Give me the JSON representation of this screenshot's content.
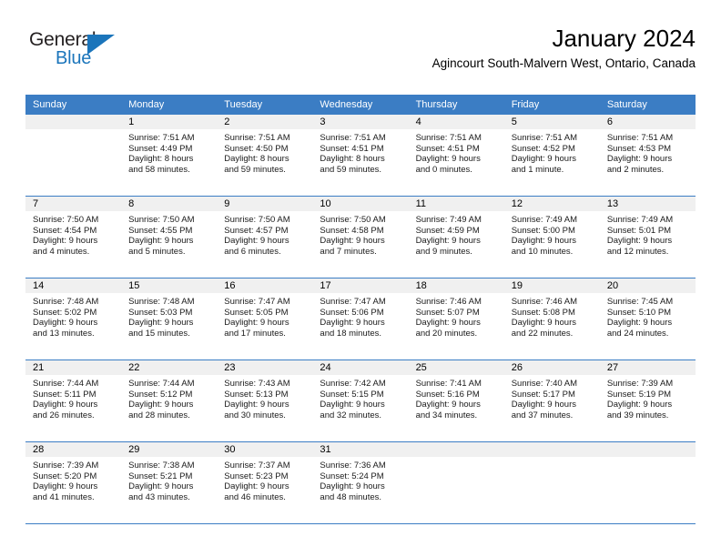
{
  "logo": {
    "word_top": "General",
    "word_bottom": "Blue",
    "accent_color": "#1b75bb"
  },
  "header": {
    "title": "January 2024",
    "subtitle": "Agincourt South-Malvern West, Ontario, Canada"
  },
  "theme": {
    "header_bg": "#3b7dc4",
    "header_text": "#ffffff",
    "daynum_bg": "#f0f0f0",
    "grid_line": "#3b7dc4"
  },
  "weekday_headers": [
    "Sunday",
    "Monday",
    "Tuesday",
    "Wednesday",
    "Thursday",
    "Friday",
    "Saturday"
  ],
  "weeks": [
    [
      {
        "day": "",
        "sunrise": "",
        "sunset": "",
        "daylight_line1": "",
        "daylight_line2": ""
      },
      {
        "day": "1",
        "sunrise": "Sunrise: 7:51 AM",
        "sunset": "Sunset: 4:49 PM",
        "daylight_line1": "Daylight: 8 hours",
        "daylight_line2": "and 58 minutes."
      },
      {
        "day": "2",
        "sunrise": "Sunrise: 7:51 AM",
        "sunset": "Sunset: 4:50 PM",
        "daylight_line1": "Daylight: 8 hours",
        "daylight_line2": "and 59 minutes."
      },
      {
        "day": "3",
        "sunrise": "Sunrise: 7:51 AM",
        "sunset": "Sunset: 4:51 PM",
        "daylight_line1": "Daylight: 8 hours",
        "daylight_line2": "and 59 minutes."
      },
      {
        "day": "4",
        "sunrise": "Sunrise: 7:51 AM",
        "sunset": "Sunset: 4:51 PM",
        "daylight_line1": "Daylight: 9 hours",
        "daylight_line2": "and 0 minutes."
      },
      {
        "day": "5",
        "sunrise": "Sunrise: 7:51 AM",
        "sunset": "Sunset: 4:52 PM",
        "daylight_line1": "Daylight: 9 hours",
        "daylight_line2": "and 1 minute."
      },
      {
        "day": "6",
        "sunrise": "Sunrise: 7:51 AM",
        "sunset": "Sunset: 4:53 PM",
        "daylight_line1": "Daylight: 9 hours",
        "daylight_line2": "and 2 minutes."
      }
    ],
    [
      {
        "day": "7",
        "sunrise": "Sunrise: 7:50 AM",
        "sunset": "Sunset: 4:54 PM",
        "daylight_line1": "Daylight: 9 hours",
        "daylight_line2": "and 4 minutes."
      },
      {
        "day": "8",
        "sunrise": "Sunrise: 7:50 AM",
        "sunset": "Sunset: 4:55 PM",
        "daylight_line1": "Daylight: 9 hours",
        "daylight_line2": "and 5 minutes."
      },
      {
        "day": "9",
        "sunrise": "Sunrise: 7:50 AM",
        "sunset": "Sunset: 4:57 PM",
        "daylight_line1": "Daylight: 9 hours",
        "daylight_line2": "and 6 minutes."
      },
      {
        "day": "10",
        "sunrise": "Sunrise: 7:50 AM",
        "sunset": "Sunset: 4:58 PM",
        "daylight_line1": "Daylight: 9 hours",
        "daylight_line2": "and 7 minutes."
      },
      {
        "day": "11",
        "sunrise": "Sunrise: 7:49 AM",
        "sunset": "Sunset: 4:59 PM",
        "daylight_line1": "Daylight: 9 hours",
        "daylight_line2": "and 9 minutes."
      },
      {
        "day": "12",
        "sunrise": "Sunrise: 7:49 AM",
        "sunset": "Sunset: 5:00 PM",
        "daylight_line1": "Daylight: 9 hours",
        "daylight_line2": "and 10 minutes."
      },
      {
        "day": "13",
        "sunrise": "Sunrise: 7:49 AM",
        "sunset": "Sunset: 5:01 PM",
        "daylight_line1": "Daylight: 9 hours",
        "daylight_line2": "and 12 minutes."
      }
    ],
    [
      {
        "day": "14",
        "sunrise": "Sunrise: 7:48 AM",
        "sunset": "Sunset: 5:02 PM",
        "daylight_line1": "Daylight: 9 hours",
        "daylight_line2": "and 13 minutes."
      },
      {
        "day": "15",
        "sunrise": "Sunrise: 7:48 AM",
        "sunset": "Sunset: 5:03 PM",
        "daylight_line1": "Daylight: 9 hours",
        "daylight_line2": "and 15 minutes."
      },
      {
        "day": "16",
        "sunrise": "Sunrise: 7:47 AM",
        "sunset": "Sunset: 5:05 PM",
        "daylight_line1": "Daylight: 9 hours",
        "daylight_line2": "and 17 minutes."
      },
      {
        "day": "17",
        "sunrise": "Sunrise: 7:47 AM",
        "sunset": "Sunset: 5:06 PM",
        "daylight_line1": "Daylight: 9 hours",
        "daylight_line2": "and 18 minutes."
      },
      {
        "day": "18",
        "sunrise": "Sunrise: 7:46 AM",
        "sunset": "Sunset: 5:07 PM",
        "daylight_line1": "Daylight: 9 hours",
        "daylight_line2": "and 20 minutes."
      },
      {
        "day": "19",
        "sunrise": "Sunrise: 7:46 AM",
        "sunset": "Sunset: 5:08 PM",
        "daylight_line1": "Daylight: 9 hours",
        "daylight_line2": "and 22 minutes."
      },
      {
        "day": "20",
        "sunrise": "Sunrise: 7:45 AM",
        "sunset": "Sunset: 5:10 PM",
        "daylight_line1": "Daylight: 9 hours",
        "daylight_line2": "and 24 minutes."
      }
    ],
    [
      {
        "day": "21",
        "sunrise": "Sunrise: 7:44 AM",
        "sunset": "Sunset: 5:11 PM",
        "daylight_line1": "Daylight: 9 hours",
        "daylight_line2": "and 26 minutes."
      },
      {
        "day": "22",
        "sunrise": "Sunrise: 7:44 AM",
        "sunset": "Sunset: 5:12 PM",
        "daylight_line1": "Daylight: 9 hours",
        "daylight_line2": "and 28 minutes."
      },
      {
        "day": "23",
        "sunrise": "Sunrise: 7:43 AM",
        "sunset": "Sunset: 5:13 PM",
        "daylight_line1": "Daylight: 9 hours",
        "daylight_line2": "and 30 minutes."
      },
      {
        "day": "24",
        "sunrise": "Sunrise: 7:42 AM",
        "sunset": "Sunset: 5:15 PM",
        "daylight_line1": "Daylight: 9 hours",
        "daylight_line2": "and 32 minutes."
      },
      {
        "day": "25",
        "sunrise": "Sunrise: 7:41 AM",
        "sunset": "Sunset: 5:16 PM",
        "daylight_line1": "Daylight: 9 hours",
        "daylight_line2": "and 34 minutes."
      },
      {
        "day": "26",
        "sunrise": "Sunrise: 7:40 AM",
        "sunset": "Sunset: 5:17 PM",
        "daylight_line1": "Daylight: 9 hours",
        "daylight_line2": "and 37 minutes."
      },
      {
        "day": "27",
        "sunrise": "Sunrise: 7:39 AM",
        "sunset": "Sunset: 5:19 PM",
        "daylight_line1": "Daylight: 9 hours",
        "daylight_line2": "and 39 minutes."
      }
    ],
    [
      {
        "day": "28",
        "sunrise": "Sunrise: 7:39 AM",
        "sunset": "Sunset: 5:20 PM",
        "daylight_line1": "Daylight: 9 hours",
        "daylight_line2": "and 41 minutes."
      },
      {
        "day": "29",
        "sunrise": "Sunrise: 7:38 AM",
        "sunset": "Sunset: 5:21 PM",
        "daylight_line1": "Daylight: 9 hours",
        "daylight_line2": "and 43 minutes."
      },
      {
        "day": "30",
        "sunrise": "Sunrise: 7:37 AM",
        "sunset": "Sunset: 5:23 PM",
        "daylight_line1": "Daylight: 9 hours",
        "daylight_line2": "and 46 minutes."
      },
      {
        "day": "31",
        "sunrise": "Sunrise: 7:36 AM",
        "sunset": "Sunset: 5:24 PM",
        "daylight_line1": "Daylight: 9 hours",
        "daylight_line2": "and 48 minutes."
      },
      {
        "day": "",
        "sunrise": "",
        "sunset": "",
        "daylight_line1": "",
        "daylight_line2": ""
      },
      {
        "day": "",
        "sunrise": "",
        "sunset": "",
        "daylight_line1": "",
        "daylight_line2": ""
      },
      {
        "day": "",
        "sunrise": "",
        "sunset": "",
        "daylight_line1": "",
        "daylight_line2": ""
      }
    ]
  ]
}
